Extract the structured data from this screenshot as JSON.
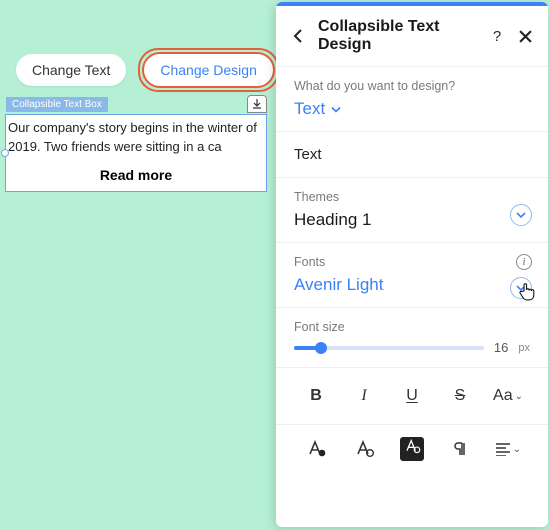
{
  "toolbar": {
    "change_text": "Change Text",
    "change_design": "Change Design"
  },
  "element": {
    "tag": "Collapsible Text Box",
    "body": "Our company's story begins in the winter of 2019. Two friends were sitting in a ca",
    "read_more": "Read more"
  },
  "panel": {
    "title": "Collapsible Text Design",
    "q_label": "What do you want to design?",
    "q_value": "Text",
    "tab": "Text",
    "themes_label": "Themes",
    "themes_value": "Heading 1",
    "fonts_label": "Fonts",
    "fonts_value": "Avenir Light",
    "size_label": "Font size",
    "size_value": "16",
    "size_unit": "px",
    "fmt": {
      "bold": "B",
      "italic": "I",
      "underline": "U",
      "strike": "S",
      "case": "Aa"
    }
  }
}
